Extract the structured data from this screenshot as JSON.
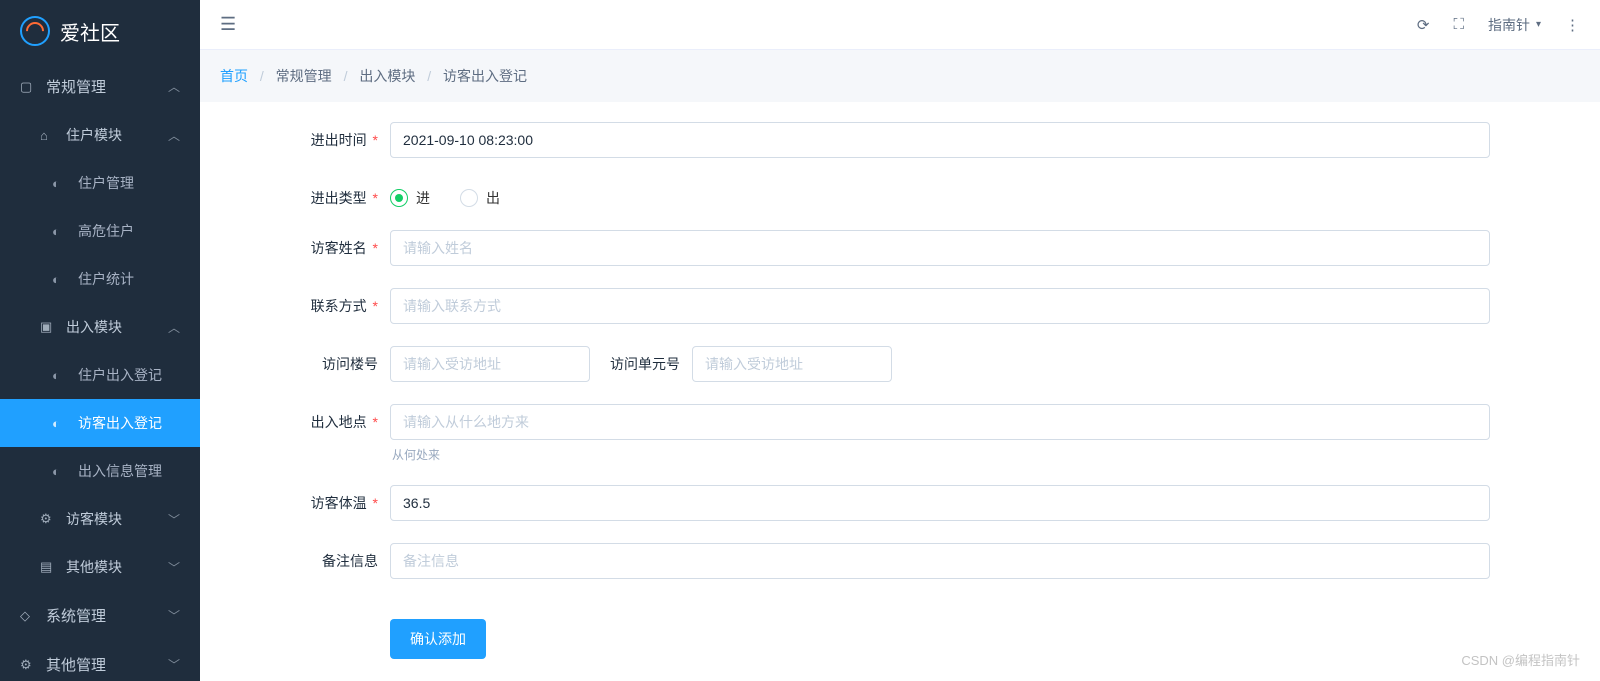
{
  "app": {
    "title": "爱社区"
  },
  "topbar": {
    "user_label": "指南针"
  },
  "breadcrumb": {
    "items": [
      "首页",
      "常规管理",
      "出入模块",
      "访客出入登记"
    ]
  },
  "sidebar": {
    "groups": [
      {
        "label": "常规管理",
        "icon": "square",
        "children": [
          {
            "label": "住户模块",
            "icon": "home",
            "children": [
              {
                "label": "住户管理",
                "icon": "dashboard"
              },
              {
                "label": "高危住户",
                "icon": "dashboard"
              },
              {
                "label": "住户统计",
                "icon": "dashboard"
              }
            ]
          },
          {
            "label": "出入模块",
            "icon": "window",
            "children": [
              {
                "label": "住户出入登记",
                "icon": "dashboard"
              },
              {
                "label": "访客出入登记",
                "icon": "dashboard",
                "active": true
              },
              {
                "label": "出入信息管理",
                "icon": "dashboard"
              }
            ]
          },
          {
            "label": "访客模块",
            "icon": "gears",
            "collapsed": true
          },
          {
            "label": "其他模块",
            "icon": "file",
            "collapsed": true
          }
        ]
      },
      {
        "label": "系统管理",
        "icon": "chat",
        "collapsed": true
      },
      {
        "label": "其他管理",
        "icon": "gear",
        "collapsed": true
      }
    ]
  },
  "form": {
    "time_label": "进出时间",
    "time_value": "2021-09-10 08:23:00",
    "type_label": "进出类型",
    "type_in": "进",
    "type_out": "出",
    "name_label": "访客姓名",
    "name_placeholder": "请输入姓名",
    "contact_label": "联系方式",
    "contact_placeholder": "请输入联系方式",
    "building_label": "访问楼号",
    "building_placeholder": "请输入受访地址",
    "unit_label": "访问单元号",
    "unit_placeholder": "请输入受访地址",
    "location_label": "出入地点",
    "location_placeholder": "请输入从什么地方来",
    "location_help": "从何处来",
    "temp_label": "访客体温",
    "temp_value": "36.5",
    "remark_label": "备注信息",
    "remark_placeholder": "备注信息",
    "submit_label": "确认添加"
  },
  "watermark": "CSDN @编程指南针"
}
